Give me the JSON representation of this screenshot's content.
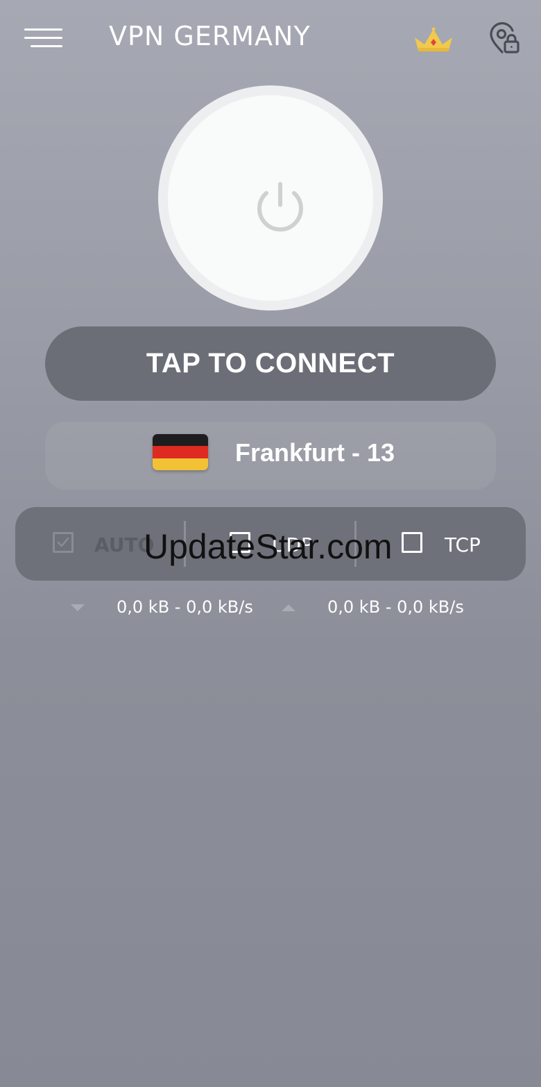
{
  "header": {
    "title": "VPN GERMANY",
    "menu_icon": "hamburger-menu-icon",
    "premium_icon": "crown-icon",
    "location_icon": "location-lock-icon"
  },
  "power": {
    "icon": "power-icon"
  },
  "connect": {
    "label": "TAP TO CONNECT"
  },
  "server": {
    "flag": "germany-flag",
    "name": "Frankfurt - 13"
  },
  "protocols": [
    {
      "label": "AUTO",
      "checked": true,
      "disabled": true
    },
    {
      "label": "UDP",
      "checked": false
    },
    {
      "label": "TCP",
      "checked": false
    }
  ],
  "stats": {
    "download": "0,0 kB - 0,0 kB/s",
    "upload": "0,0 kB - 0,0 kB/s"
  },
  "watermark": "UpdateStar.com",
  "colors": {
    "background": "#9a9ca7",
    "connect_button": "#6b6e77",
    "protocol_bar": "#6e717a",
    "crown": "#f2c94c",
    "crown_gem": "#e0483a",
    "flag_black": "#1d1d1f",
    "flag_red": "#dd2b22",
    "flag_gold": "#f2c234"
  }
}
